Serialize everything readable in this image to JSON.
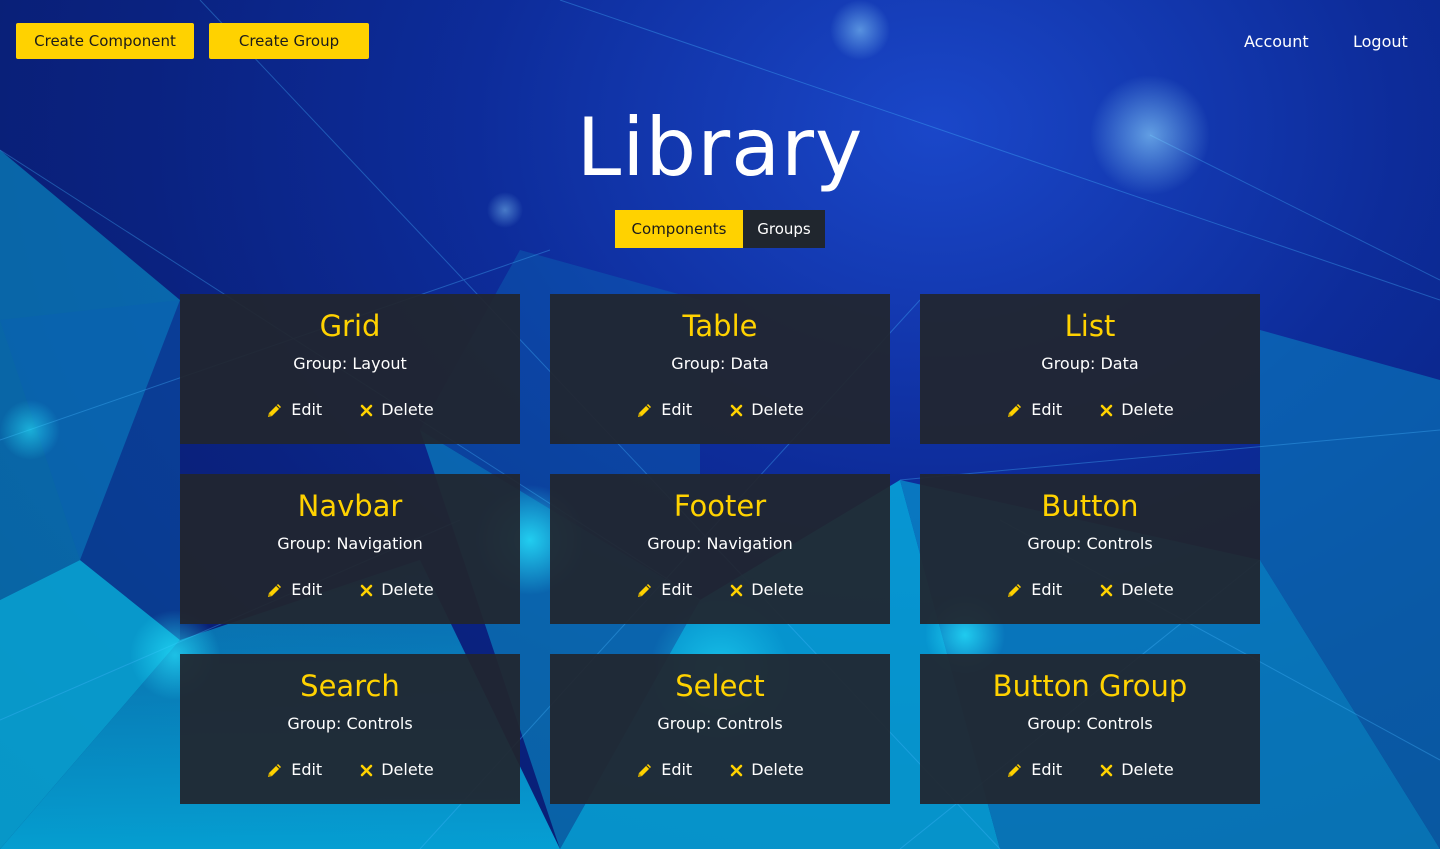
{
  "header": {
    "create_component_label": "Create Component",
    "create_group_label": "Create Group",
    "account_label": "Account",
    "logout_label": "Logout"
  },
  "page": {
    "title": "Library"
  },
  "tabs": [
    {
      "label": "Components",
      "active": true
    },
    {
      "label": "Groups",
      "active": false
    }
  ],
  "cards": [
    {
      "name": "Grid",
      "group": "Group: Layout"
    },
    {
      "name": "Table",
      "group": "Group: Data"
    },
    {
      "name": "List",
      "group": "Group: Data"
    },
    {
      "name": "Navbar",
      "group": "Group: Navigation"
    },
    {
      "name": "Footer",
      "group": "Group: Navigation"
    },
    {
      "name": "Button",
      "group": "Group: Controls"
    },
    {
      "name": "Search",
      "group": "Group: Controls"
    },
    {
      "name": "Select",
      "group": "Group: Controls"
    },
    {
      "name": "Button Group",
      "group": "Group: Controls"
    }
  ],
  "actions": {
    "edit_label": "Edit",
    "delete_label": "Delete",
    "edit_icon": "pencil-icon",
    "delete_icon": "close-icon"
  },
  "colors": {
    "accent": "#ffd200",
    "card_bg": "#21262e",
    "background": "#0d2c9a"
  }
}
